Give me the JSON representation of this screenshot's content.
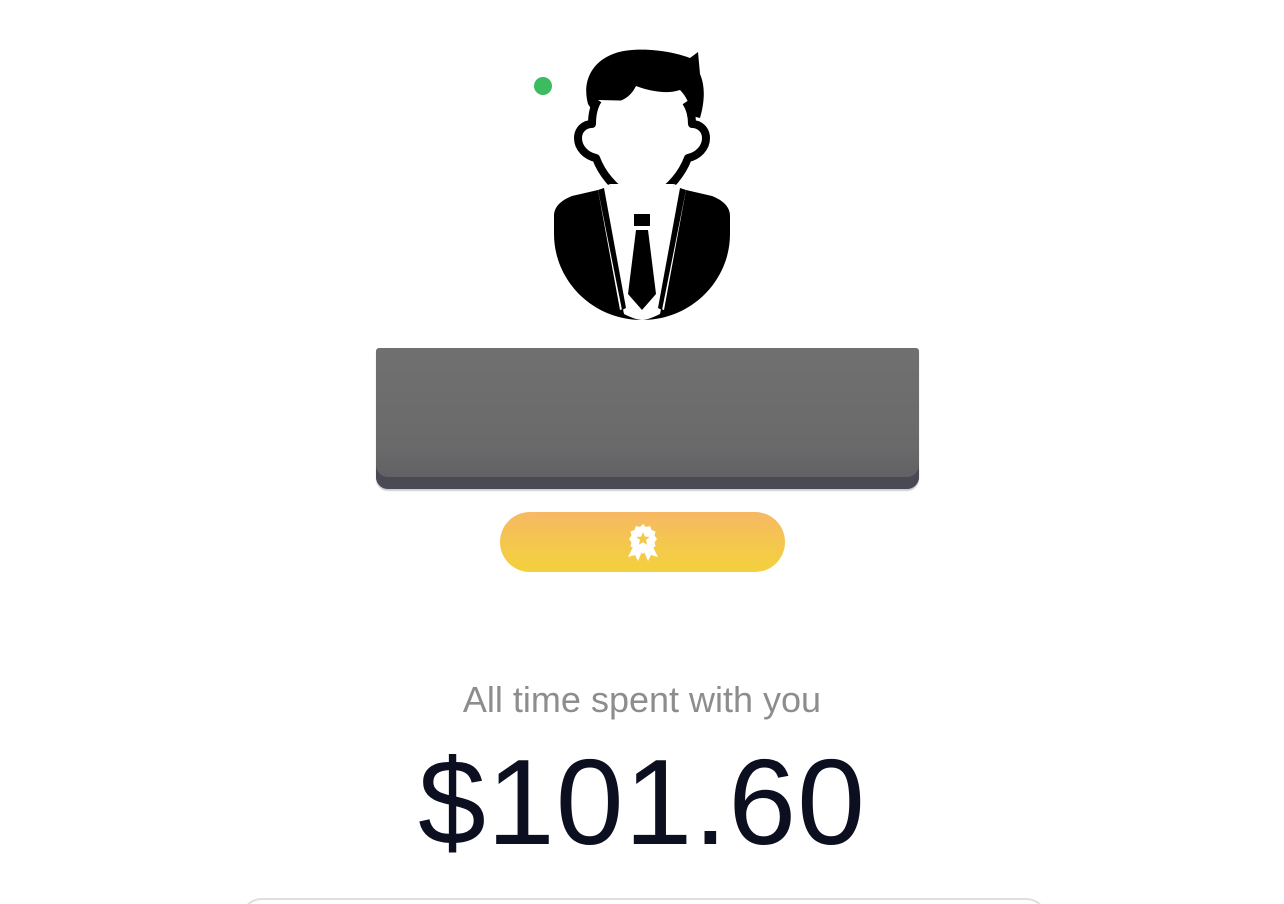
{
  "profile": {
    "avatar_icon": "businessman-avatar-icon",
    "online_status_color": "#3dbb61",
    "name_redacted": true,
    "rank_badge_icon": "award-ribbon-icon",
    "rank_badge_colors": [
      "#f7b865",
      "#f3d03e"
    ]
  },
  "stats": {
    "spent_label": "All time spent with you",
    "spent_amount": "$101.60"
  }
}
